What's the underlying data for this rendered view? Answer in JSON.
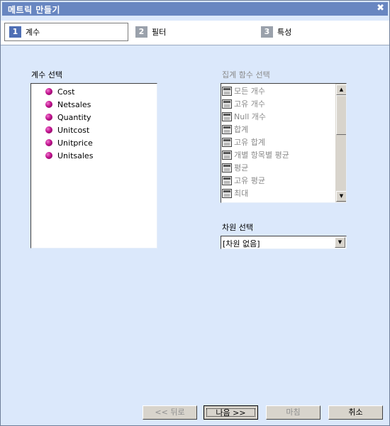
{
  "window": {
    "title": "메트릭 만들기",
    "close_icon": "close-x-icon"
  },
  "steps": [
    {
      "number": "1",
      "label": "계수",
      "active": true
    },
    {
      "number": "2",
      "label": "필터",
      "active": false
    },
    {
      "number": "3",
      "label": "특성",
      "active": false
    }
  ],
  "measure_section": {
    "label": "계수 선택",
    "icon": "measure-dot-icon",
    "items": [
      "Cost",
      "Netsales",
      "Quantity",
      "Unitcost",
      "Unitprice",
      "Unitsales"
    ]
  },
  "aggregate_section": {
    "label": "집계 함수 선택",
    "icon": "calculator-icon",
    "disabled": true,
    "items": [
      "모든 개수",
      "고유 개수",
      "Null 개수",
      "합계",
      "고유 합계",
      "개별 항목별 평균",
      "평균",
      "고유 평균",
      "최대"
    ]
  },
  "dimension_section": {
    "label": "차원 선택",
    "selected": "[차원 없음]"
  },
  "buttons": {
    "back": "<< 뒤로",
    "next": "나음 >>",
    "finish": "마침",
    "cancel": "취소"
  },
  "colors": {
    "titlebar": "#6886c1",
    "background": "#dbe8fb",
    "active_step": "#4f6fb5",
    "inactive_step": "#9aa1ab",
    "measure_dot": "#c2138f"
  }
}
